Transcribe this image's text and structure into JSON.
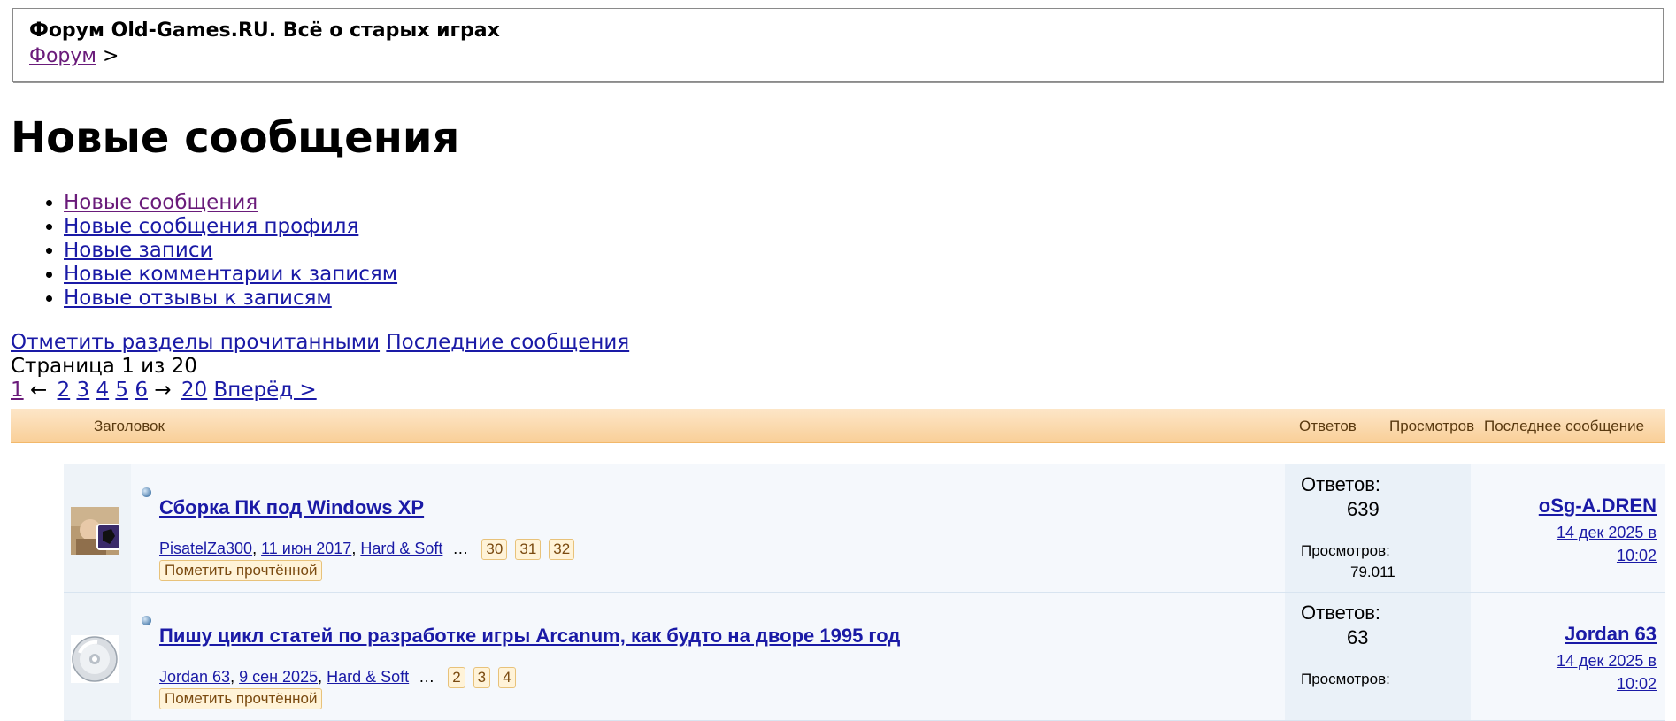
{
  "header": {
    "site_title": "Форум Old-Games.RU. Всё о старых играх",
    "breadcrumb_link": "Форум",
    "breadcrumb_sep": ">"
  },
  "page": {
    "title": "Новые сообщения"
  },
  "nav": [
    "Новые сообщения",
    "Новые сообщения профиля",
    "Новые записи",
    "Новые комментарии к записям",
    "Новые отзывы к записям"
  ],
  "actions": {
    "mark_read": "Отметить разделы прочитанными",
    "latest": "Последние сообщения"
  },
  "page_info": "Страница 1 из 20",
  "pager": {
    "current": "1",
    "left_arrow": "←",
    "pages": [
      "2",
      "3",
      "4",
      "5",
      "6"
    ],
    "right_arrow": "→",
    "last": "20",
    "next": "Вперёд >"
  },
  "table_header": {
    "title": "Заголовок",
    "replies": "Ответов",
    "views": "Просмотров",
    "last_post": "Последнее сообщение"
  },
  "topics": [
    {
      "title": "Сборка ПК под Windows XP",
      "author": "PisatelZa300",
      "date": "11 июн 2017",
      "forum": "Hard & Soft",
      "ellipsis": "…",
      "pages": [
        "30",
        "31",
        "32"
      ],
      "mark_read": "Пометить прочтённой",
      "replies_label": "Ответов:",
      "replies": "639",
      "views_label": "Просмотров:",
      "views": "79.011",
      "last_user": "oSg-A.DREN",
      "last_date": "14 дек 2025 в 10:02"
    },
    {
      "title": "Пишу цикл статей по разработке игры Arcanum, как будто на дворе 1995 год",
      "author": "Jordan 63",
      "date": "9 сен 2025",
      "forum": "Hard & Soft",
      "ellipsis": "…",
      "pages": [
        "2",
        "3",
        "4"
      ],
      "mark_read": "Пометить прочтённой",
      "replies_label": "Ответов:",
      "replies": "63",
      "views_label": "Просмотров:",
      "views": "",
      "last_user": "Jordan 63",
      "last_date": "14 дек 2025 в 10:02"
    }
  ]
}
